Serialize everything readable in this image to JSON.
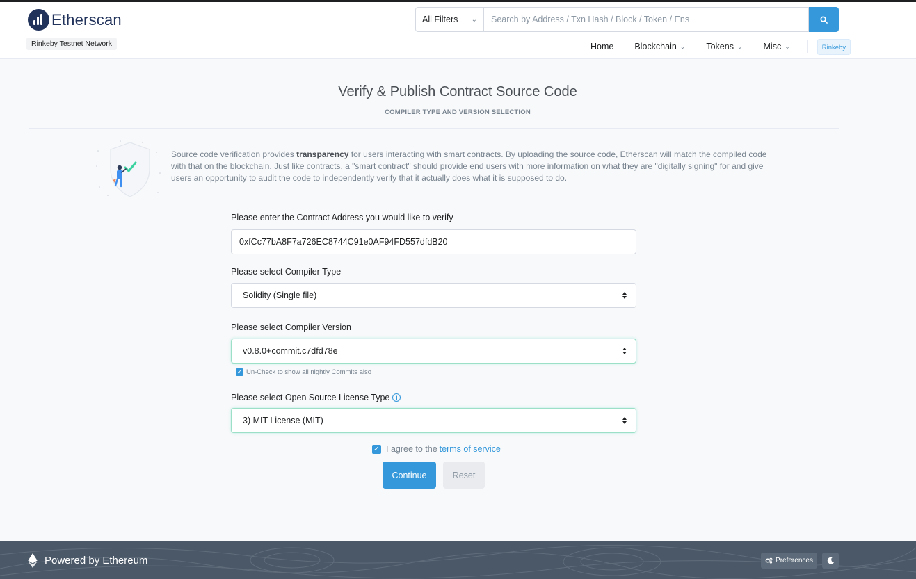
{
  "header": {
    "logo_text": "Etherscan",
    "network_badge": "Rinkeby Testnet Network",
    "search": {
      "filter_label": "All Filters",
      "placeholder": "Search by Address / Txn Hash / Block / Token / Ens"
    },
    "nav": {
      "home": "Home",
      "blockchain": "Blockchain",
      "tokens": "Tokens",
      "misc": "Misc",
      "network_button": "Rinkeby"
    }
  },
  "main": {
    "title": "Verify & Publish Contract Source Code",
    "subtitle": "COMPILER TYPE AND VERSION SELECTION",
    "intro": {
      "part1": "Source code verification provides ",
      "bold": "transparency",
      "part2": " for users interacting with smart contracts. By uploading the source code, Etherscan will match the compiled code with that on the blockchain. Just like contracts, a \"smart contract\" should provide end users with more information on what they are \"digitally signing\" for and give users an opportunity to audit the code to independently verify that it actually does what it is supposed to do."
    },
    "form": {
      "address_label": "Please enter the Contract Address you would like to verify",
      "address_value": "0xfCc77bA8F7a726EC8744C91e0AF94FD557dfdB20",
      "compiler_type_label": "Please select Compiler Type",
      "compiler_type_value": "Solidity (Single file)",
      "compiler_version_label": "Please select Compiler Version",
      "compiler_version_value": "v0.8.0+commit.c7dfd78e",
      "nightly_checkbox_label": "Un-Check to show all nightly Commits also",
      "license_label": "Please select Open Source License Type",
      "license_value": "3) MIT License (MIT)",
      "agree_text": "I agree to the",
      "terms_link": "terms of service",
      "continue_label": "Continue",
      "reset_label": "Reset"
    }
  },
  "footer": {
    "powered_by": "Powered by Ethereum",
    "preferences_label": "Preferences"
  },
  "colors": {
    "accent": "#3498db",
    "brand_dark": "#21325b",
    "footer_bg": "#4a5868",
    "focus_border": "#9be0c7"
  },
  "icons": [
    "etherscan-logo-icon",
    "search-icon",
    "chevron-down-icon",
    "info-icon",
    "check-icon",
    "ethereum-icon",
    "gears-icon",
    "moon-icon"
  ]
}
